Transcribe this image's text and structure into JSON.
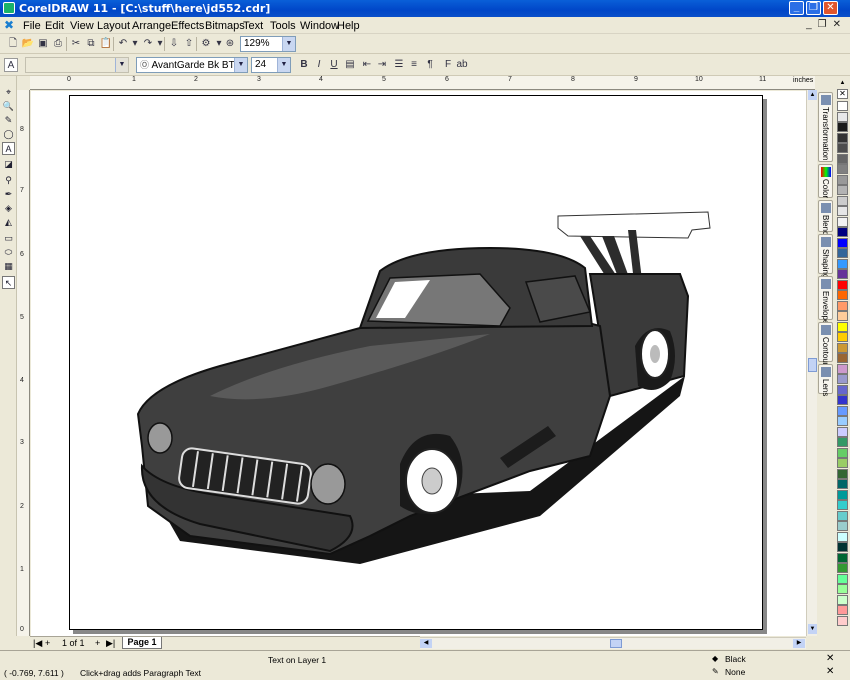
{
  "window": {
    "title": "CorelDRAW 11 - [C:\\stuff\\here\\jd552.cdr]"
  },
  "menu": [
    "File",
    "Edit",
    "View",
    "Layout",
    "Arrange",
    "Effects",
    "Bitmaps",
    "Text",
    "Tools",
    "Window",
    "Help"
  ],
  "toolbar": {
    "zoom_value": "129%"
  },
  "text_toolbar": {
    "font_value": "AvantGarde Bk BT",
    "size_value": "24"
  },
  "ruler": {
    "unit": "inches",
    "h_labels": [
      "0",
      "1",
      "2",
      "3",
      "4",
      "5",
      "6",
      "7",
      "8",
      "9",
      "10",
      "11"
    ],
    "v_labels": [
      "8",
      "7",
      "6",
      "5",
      "4",
      "3",
      "2",
      "1",
      "0"
    ]
  },
  "dockers": [
    "Transformation",
    "Color",
    "Blend",
    "Shaping",
    "Envelope",
    "Contour",
    "Lens"
  ],
  "palette_colors": [
    "#ffffff",
    "#e8e8e8",
    "#1a1a1a",
    "#333333",
    "#4d4d4d",
    "#666666",
    "#808080",
    "#999999",
    "#b3b3b3",
    "#cccccc",
    "#e6e6e6",
    "#f2f2f2",
    "#000080",
    "#0000ff",
    "#336699",
    "#3399ff",
    "#663399",
    "#ff0000",
    "#ff6600",
    "#ff9966",
    "#ffcc99",
    "#ffff00",
    "#ffcc00",
    "#cc9933",
    "#996633",
    "#cc99cc",
    "#9999cc",
    "#6666cc",
    "#3333cc",
    "#6699ff",
    "#99ccff",
    "#ccccff",
    "#339966",
    "#66cc66",
    "#99cc66",
    "#336633",
    "#006666",
    "#009999",
    "#33cccc",
    "#66cccc",
    "#99cccc",
    "#ccffff",
    "#003333",
    "#006633",
    "#339933",
    "#66ff99",
    "#99ff99",
    "#ccffcc",
    "#ff9999",
    "#ffcccc"
  ],
  "pagebar": {
    "page_count": "1 of 1",
    "page_tab": "Page 1"
  },
  "status": {
    "layer": "Text on Layer 1",
    "coords": "( -0.769, 7.611 )",
    "hint": "Click+drag adds Paragraph Text",
    "fill": "Black",
    "outline": "None"
  }
}
